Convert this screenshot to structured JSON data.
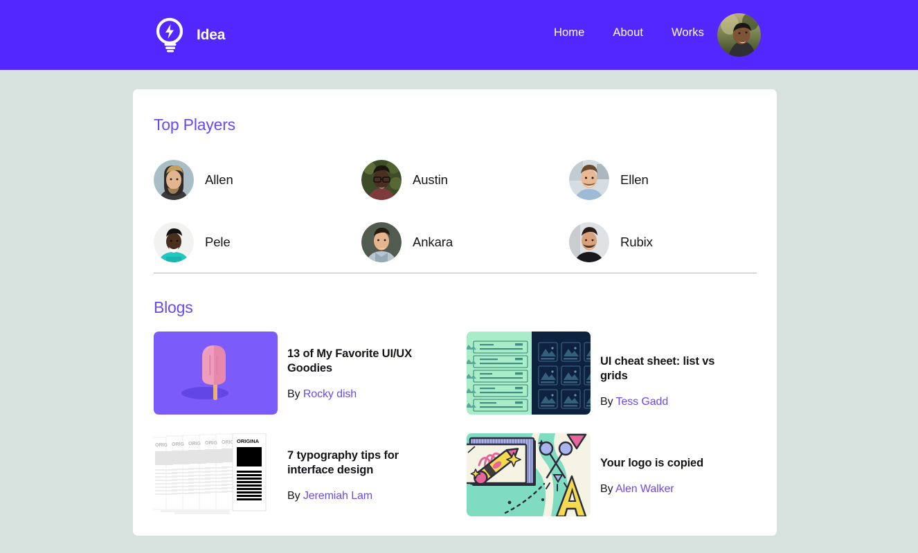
{
  "theme": {
    "header_bg": "#5327ff",
    "page_bg": "#d7e2de",
    "card_bg": "#ffffff",
    "accent": "#6a48f5",
    "text": "#13131a"
  },
  "header": {
    "brand_name": "Idea",
    "logo_icon": "lightbulb-lightning-icon",
    "nav": [
      {
        "label": "Home"
      },
      {
        "label": "About"
      },
      {
        "label": "Works"
      }
    ],
    "avatar_icon": "user-avatar"
  },
  "players_section": {
    "title": "Top Players",
    "players": [
      {
        "name": "Allen",
        "avatar_icon": "player-avatar-allen"
      },
      {
        "name": "Austin",
        "avatar_icon": "player-avatar-austin"
      },
      {
        "name": "Ellen",
        "avatar_icon": "player-avatar-ellen"
      },
      {
        "name": "Pele",
        "avatar_icon": "player-avatar-pele"
      },
      {
        "name": "Ankara",
        "avatar_icon": "player-avatar-ankara"
      },
      {
        "name": "Rubix",
        "avatar_icon": "player-avatar-rubix"
      }
    ]
  },
  "blogs_section": {
    "title": "Blogs",
    "by_label": "By",
    "blogs": [
      {
        "title": "13 of My Favorite UI/UX Goodies",
        "author": "Rocky dish",
        "thumb_icon": "popsicle-illustration"
      },
      {
        "title": "UI cheat sheet: list vs grids",
        "author": "Tess Gadd",
        "thumb_icon": "list-vs-grid-illustration"
      },
      {
        "title": "7 typography tips for interface design",
        "author": "Jeremiah Lam",
        "thumb_icon": "stacked-papers-illustration"
      },
      {
        "title": "Your logo is copied",
        "author": "Alen Walker",
        "thumb_icon": "pencil-scissors-illustration"
      }
    ]
  }
}
